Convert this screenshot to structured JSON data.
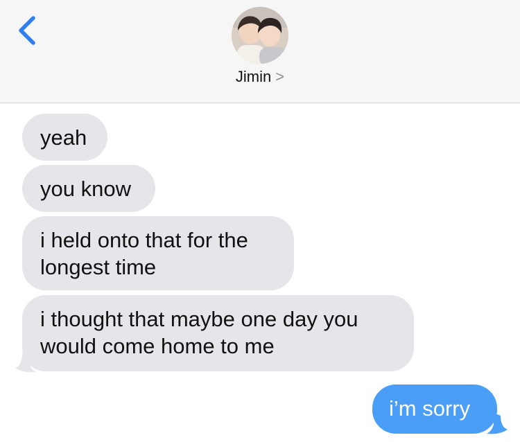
{
  "header": {
    "contact_name": "Jimin",
    "contact_chevron": ">",
    "avatar_icon": "contact-photo",
    "back_icon": "chevron-left-icon",
    "accent_color": "#2f80ed"
  },
  "messages": [
    {
      "direction": "incoming",
      "lines": [
        "yeah"
      ]
    },
    {
      "direction": "incoming",
      "lines": [
        "you know"
      ]
    },
    {
      "direction": "incoming",
      "lines": [
        "i held onto that for the",
        "longest time"
      ]
    },
    {
      "direction": "incoming",
      "lines": [
        "i thought that maybe one day you",
        "would come home to me"
      ]
    },
    {
      "direction": "outgoing",
      "lines": [
        "i’m sorry"
      ]
    }
  ],
  "colors": {
    "incoming_bubble": "#e5e5ea",
    "outgoing_bubble": "#4a9ef6",
    "header_bg": "#f6f6f6"
  }
}
